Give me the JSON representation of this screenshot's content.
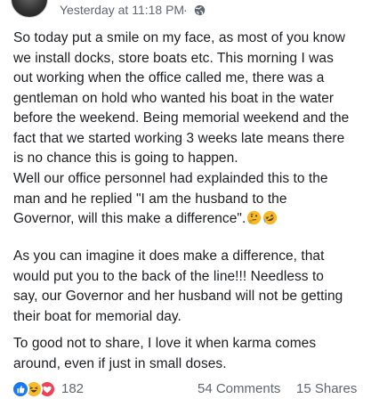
{
  "post": {
    "timestamp": "Yesterday at 11:18 PM",
    "separator": "·",
    "privacy_icon": "globe-icon",
    "paragraphs": [
      "So today put a smile on my face, as most of you know\nwe install docks, store boats etc. This morning I was\nout working when the office called me, there was a\ngentleman on hold who wanted his boat in the water\nbefore the weekend. Being memorial weekend and the\nfact that we started working 3 weeks late means there\nis no chance this is going to happen.",
      "Well our office personnel had explainded this to the\nman and he replied \"I am the husband to the\nGovernor, will this make a difference\".",
      "As you can imagine it does make a difference, that\nwould put you to the back of the line!!! Needless to\nsay,  our Governor and her husband will not be getting\ntheir boat for memorial day.",
      "To good not to share, I love it when karma comes\naround, even if just in small doses."
    ],
    "inline_emojis": [
      "thinking-face-icon",
      "rofl-face-icon"
    ]
  },
  "footer": {
    "reaction_icons": [
      "like-icon",
      "haha-icon",
      "love-icon"
    ],
    "reaction_count": "182",
    "comments_label": "54 Comments",
    "shares_label": "15 Shares"
  },
  "colors": {
    "text": "#1c1e21",
    "meta": "#616770",
    "like": "#1877f2",
    "haha": "#f7b928",
    "love": "#f33e58"
  }
}
